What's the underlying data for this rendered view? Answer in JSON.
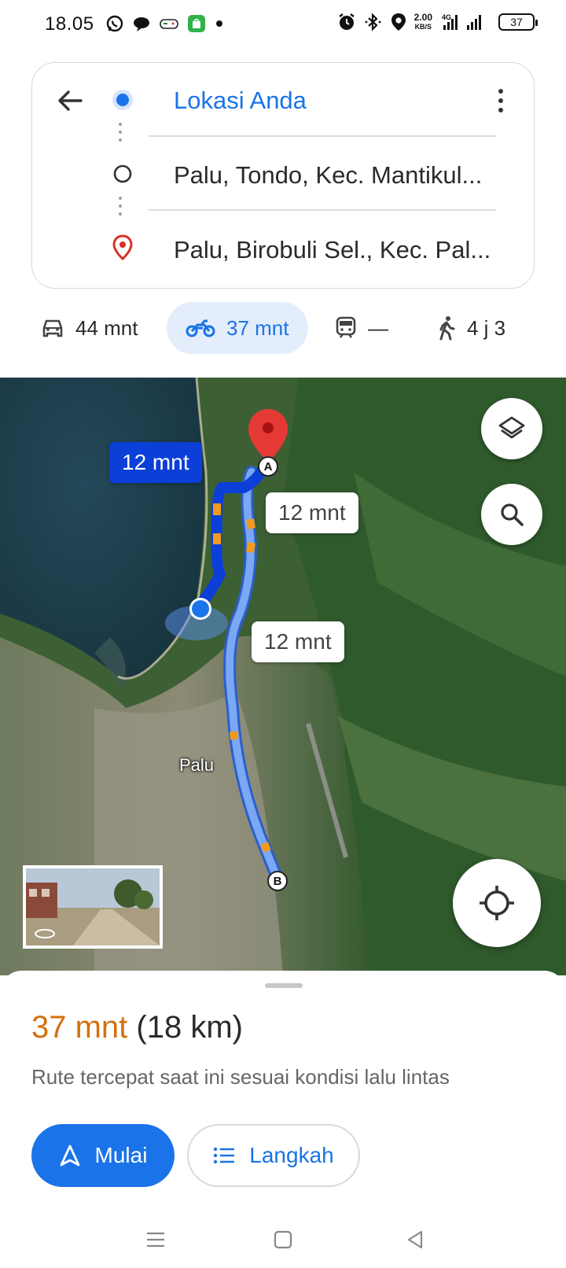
{
  "status_bar": {
    "time": "18.05",
    "speed_value": "2.00",
    "speed_unit": "KB/S",
    "network": "4G",
    "battery": "37",
    "icons": [
      "whatsapp-icon",
      "chat-icon",
      "gamepad-icon",
      "shop-icon",
      "dot-icon",
      "alarm-icon",
      "bluetooth-icon",
      "location-icon",
      "signal-icon"
    ]
  },
  "directions": {
    "origin": "Lokasi Anda",
    "stop": "Palu, Tondo, Kec. Mantikul...",
    "destination": "Palu, Birobuli Sel., Kec. Pal..."
  },
  "modes": [
    {
      "icon": "car-icon",
      "label": "44 mnt"
    },
    {
      "icon": "motorcycle-icon",
      "label": "37 mnt",
      "active": true
    },
    {
      "icon": "train-icon",
      "label": "—"
    },
    {
      "icon": "walk-icon",
      "label": "4 j 3"
    }
  ],
  "map": {
    "city_label": "Palu",
    "route_labels": [
      "12 mnt",
      "12 mnt",
      "12 mnt"
    ],
    "marker_a": "A",
    "marker_b": "B"
  },
  "sheet": {
    "duration": "37 mnt",
    "distance": "(18 km)",
    "description": "Rute tercepat saat ini sesuai kondisi lalu lintas",
    "start_label": "Mulai",
    "steps_label": "Langkah"
  },
  "colors": {
    "accent": "#1a73e8",
    "duration": "#d4700c",
    "route_primary": "#0b3fd8",
    "route_alt": "#7aa8f5",
    "destination_pin": "#d93025"
  }
}
